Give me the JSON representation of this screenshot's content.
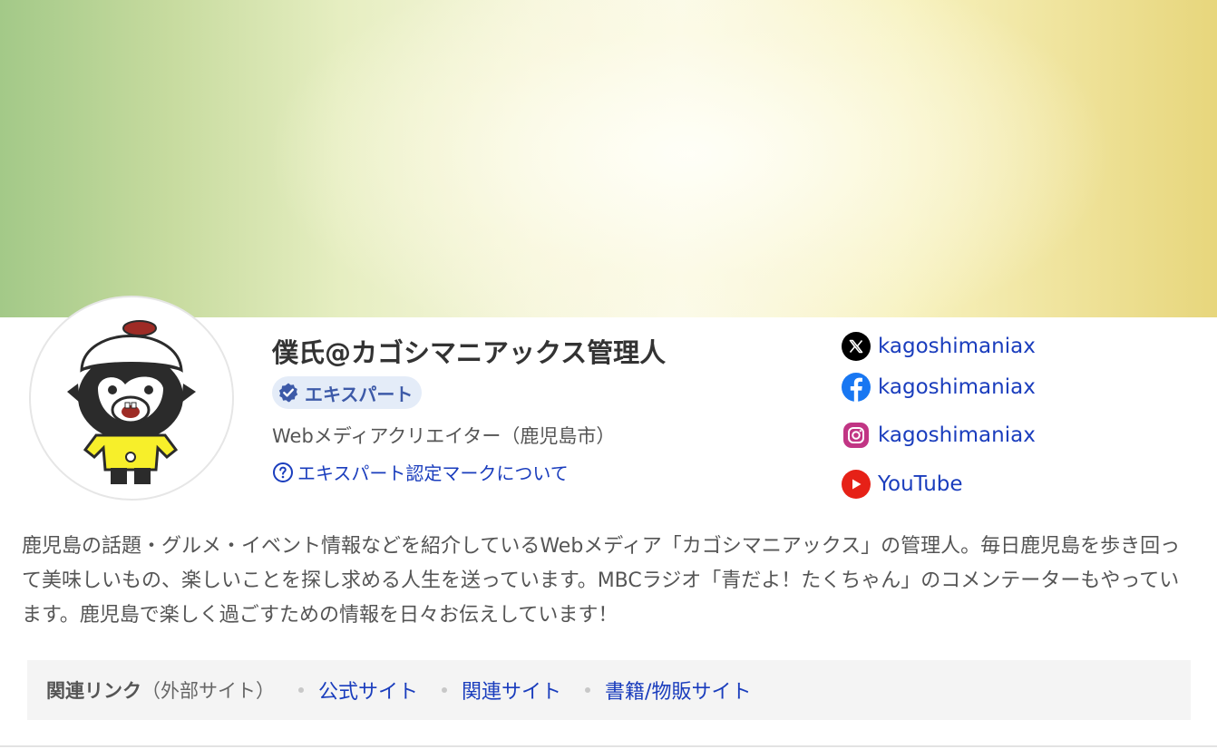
{
  "profile": {
    "name": "僕氏@カゴシマニアックス管理人",
    "badge_label": "エキスパート",
    "occupation": "Webメディアクリエイター（鹿児島市）",
    "about_mark_link": "エキスパート認定マークについて",
    "bio": "鹿児島の話題・グルメ・イベント情報などを紹介しているWebメディア「カゴシマニアックス」の管理人。毎日鹿児島を歩き回って美味しいもの、楽しいことを探し求める人生を送っています。MBCラジオ「青だよ！たくちゃん」のコメンテーターもやっています。鹿児島で楽しく過ごすための情報を日々お伝えしています！"
  },
  "social": [
    {
      "icon": "x-icon",
      "label": "kagoshimaniax",
      "color": "#000000"
    },
    {
      "icon": "facebook-icon",
      "label": "kagoshimaniax",
      "color": "#1877f2"
    },
    {
      "icon": "instagram-icon",
      "label": "kagoshimaniax",
      "color": "#c13584"
    },
    {
      "icon": "youtube-icon",
      "label": "YouTube",
      "color": "#e62117"
    }
  ],
  "related_links": {
    "title": "関連リンク",
    "note": "（外部サイト）",
    "items": [
      {
        "label": "公式サイト"
      },
      {
        "label": "関連サイト"
      },
      {
        "label": "書籍/物販サイト"
      }
    ]
  },
  "colors": {
    "link": "#1a3dbd",
    "badge_bg": "#e4ecf8",
    "badge_text": "#3d5aa8",
    "related_bg": "#f4f4f4"
  }
}
